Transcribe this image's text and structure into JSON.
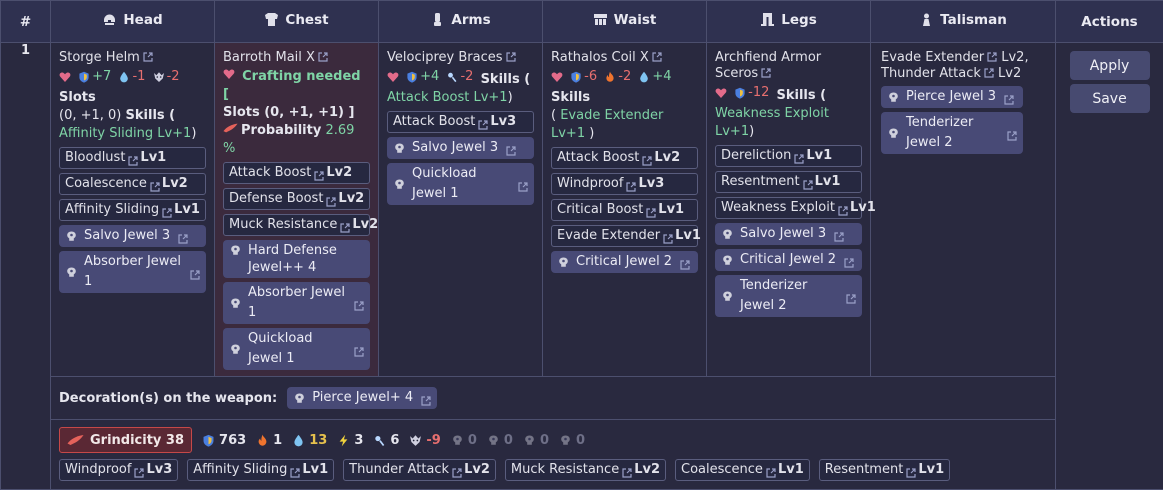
{
  "header": {
    "index": "#",
    "head": "Head",
    "chest": "Chest",
    "arms": "Arms",
    "waist": "Waist",
    "legs": "Legs",
    "talisman": "Talisman",
    "actions": "Actions"
  },
  "row": {
    "index": "1",
    "head": {
      "name": "Storge Helm",
      "defense": "+7",
      "water": "-1",
      "dragon": "-2",
      "slots_label": "Slots",
      "slots_values": "(0, +1, 0)",
      "skills_label": "Skills (",
      "skills_value": "Affinity Sliding Lv+1",
      "skills_close": ")",
      "skills": [
        {
          "name": "Bloodlust",
          "lv": "Lv1"
        },
        {
          "name": "Coalescence",
          "lv": "Lv2"
        },
        {
          "name": "Affinity Sliding",
          "lv": "Lv1"
        }
      ],
      "jewels": [
        "Salvo Jewel 3",
        "Absorber Jewel 1"
      ]
    },
    "chest": {
      "name": "Barroth Mail X",
      "crafting": "Crafting needed [",
      "slots_text": "Slots (0, +1, +1) ]",
      "probability_label": "Probability",
      "probability_value": "2.69 %",
      "skills": [
        {
          "name": "Attack Boost",
          "lv": "Lv2"
        },
        {
          "name": "Defense Boost",
          "lv": "Lv2"
        },
        {
          "name": "Muck Resistance",
          "lv": "Lv2"
        }
      ],
      "jewels": [
        "Hard Defense Jewel++ 4",
        "Absorber Jewel 1",
        "Quickload Jewel 1"
      ]
    },
    "arms": {
      "name": "Velociprey Braces",
      "defense": "+4",
      "ice": "-2",
      "skills_label": "Skills (",
      "skills_value": "Attack Boost Lv+1",
      "skills_close": ")",
      "skills": [
        {
          "name": "Attack Boost",
          "lv": "Lv3"
        }
      ],
      "jewels": [
        "Salvo Jewel 3",
        "Quickload Jewel 1"
      ]
    },
    "waist": {
      "name": "Rathalos Coil X",
      "defense": "-6",
      "fire": "-2",
      "water": "+4",
      "skills_label": "Skills",
      "skills_value": "Evade Extender Lv+1",
      "skills_open": "(",
      "skills_close": ")",
      "skills": [
        {
          "name": "Attack Boost",
          "lv": "Lv2"
        },
        {
          "name": "Windproof",
          "lv": "Lv3"
        },
        {
          "name": "Critical Boost",
          "lv": "Lv1"
        },
        {
          "name": "Evade Extender",
          "lv": "Lv1"
        }
      ],
      "jewels": [
        "Critical Jewel 2"
      ]
    },
    "legs": {
      "name": "Archfiend Armor Sceros",
      "defense": "-12",
      "skills_label": "Skills (",
      "skills_value": "Weakness Exploit Lv+1",
      "skills_close": ")",
      "skills": [
        {
          "name": "Dereliction",
          "lv": "Lv1"
        },
        {
          "name": "Resentment",
          "lv": "Lv1"
        },
        {
          "name": "Weakness Exploit",
          "lv": "Lv1"
        }
      ],
      "jewels": [
        "Salvo Jewel 3",
        "Critical Jewel 2",
        "Tenderizer Jewel 2"
      ]
    },
    "talisman": {
      "skill1_name": "Evade Extender",
      "skill1_lv": "Lv2,",
      "skill2_name": "Thunder Attack",
      "skill2_lv": "Lv2",
      "jewels": [
        "Pierce Jewel 3",
        "Tenderizer Jewel 2"
      ]
    },
    "actions": {
      "apply": "Apply",
      "save": "Save"
    }
  },
  "weapon_decorations": {
    "label": "Decoration(s) on the weapon:",
    "jewel": "Pierce Jewel+ 4"
  },
  "summary": {
    "weapon": "Grindicity 38",
    "defense": "763",
    "fire": "1",
    "water": "13",
    "thunder": "3",
    "ice": "6",
    "dragon": "-9",
    "slot4": "0",
    "slot3": "0",
    "slot2": "0",
    "slot1": "0",
    "skills": [
      {
        "name": "Windproof",
        "lv": "Lv3"
      },
      {
        "name": "Affinity Sliding",
        "lv": "Lv1"
      },
      {
        "name": "Thunder Attack",
        "lv": "Lv2"
      },
      {
        "name": "Muck Resistance",
        "lv": "Lv2"
      },
      {
        "name": "Coalescence",
        "lv": "Lv1"
      },
      {
        "name": "Resentment",
        "lv": "Lv1"
      }
    ]
  },
  "colors": {
    "background": "#232539",
    "header": "#2f3150",
    "chest_highlight": "#3b2a3d",
    "jewel": "#484a76",
    "positive": "#7fd4a6",
    "negative": "#e76f6f",
    "skill_value": "#7fd4a6"
  },
  "icons": [
    "helmet-icon",
    "chest-icon",
    "arms-icon",
    "waist-icon",
    "legs-icon",
    "talisman-icon",
    "shield-icon",
    "water-icon",
    "dragon-icon",
    "heart-icon",
    "fire-icon",
    "ice-icon",
    "thunder-icon",
    "jewel-icon",
    "external-link-icon",
    "weapon-icon",
    "slot-icon"
  ]
}
